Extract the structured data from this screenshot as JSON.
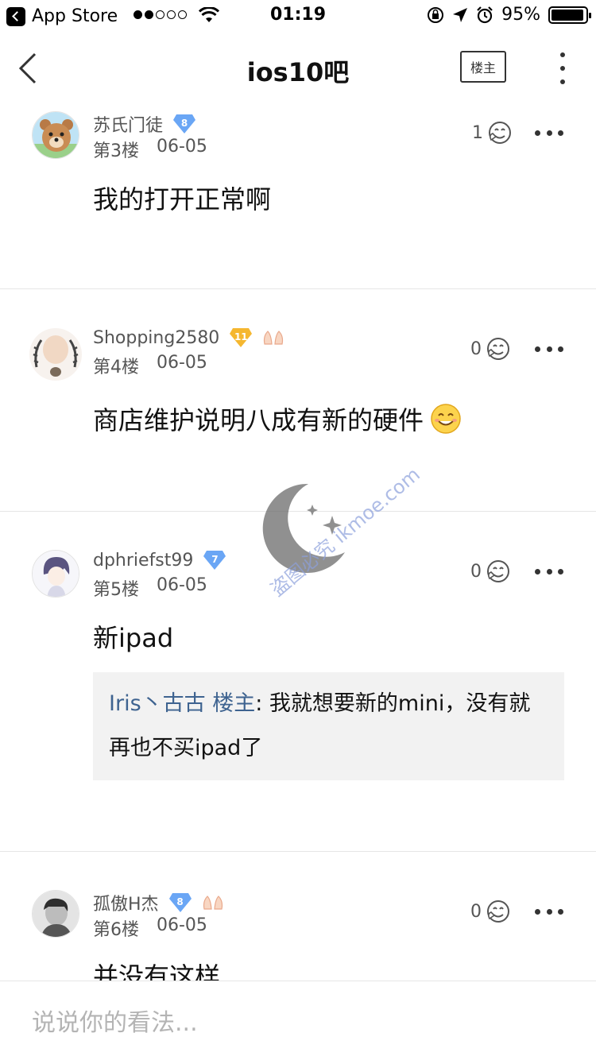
{
  "status_bar": {
    "back_app": "App Store",
    "time": "01:19",
    "battery": "95%",
    "battery_level": 0.95
  },
  "nav": {
    "title": "ios10吧",
    "owner_label": "楼主"
  },
  "posts": [
    {
      "username": "苏氏门徒",
      "level": "8",
      "floor": "第3楼",
      "date": "06-05",
      "likes": "1",
      "content": "我的打开正常啊"
    },
    {
      "username": "Shopping2580",
      "level": "11",
      "floor": "第4楼",
      "date": "06-05",
      "likes": "0",
      "content": "商店维护说明八成有新的硬件"
    },
    {
      "username": "dphriefst99",
      "level": "7",
      "floor": "第5楼",
      "date": "06-05",
      "likes": "0",
      "content": "新ipad",
      "quote": {
        "author": "Iris丶古古 楼主",
        "text": ": 我就想要新的mini，没有就再也不买ipad了"
      }
    },
    {
      "username": "孤傲H杰",
      "level": "8",
      "floor": "第6楼",
      "date": "06-05",
      "likes": "0",
      "content": "并没有这样"
    }
  ],
  "watermark": {
    "text": "盗图必究 ikmoe.com"
  },
  "comment": {
    "placeholder": "说说你的看法..."
  },
  "colors": {
    "level_blue": "#6aa6f5",
    "level_gold": "#f5b730",
    "quote_author": "#3e6390",
    "divider": "#e6e6e6"
  }
}
